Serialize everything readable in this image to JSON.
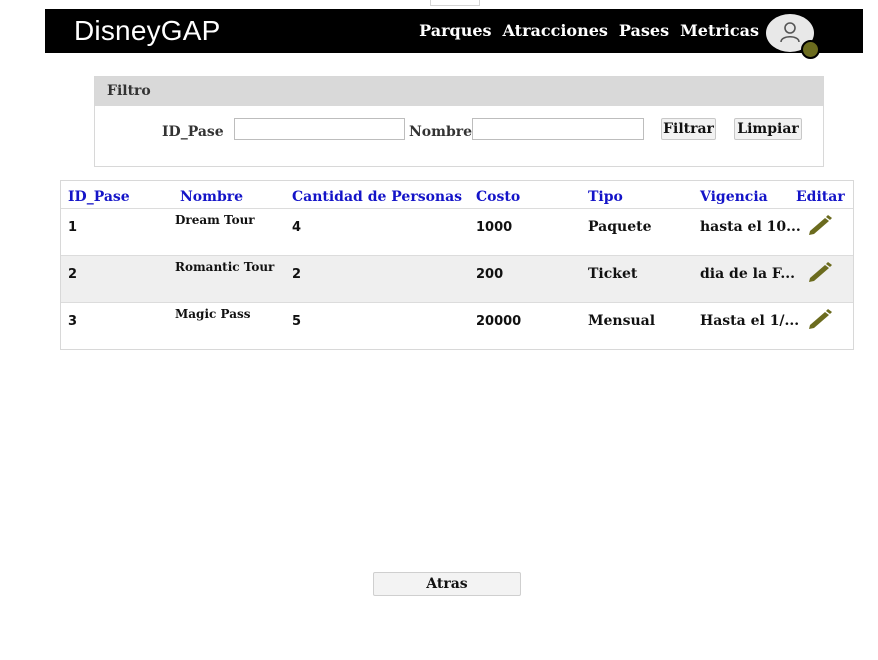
{
  "app": {
    "brand": "DisneyGAP"
  },
  "nav": {
    "items": [
      "Parques",
      "Atracciones",
      "Pases",
      "Metricas"
    ]
  },
  "filter": {
    "title": "Filtro",
    "id_label": "ID_Pase",
    "id_value": "",
    "name_label": "Nombre",
    "name_value": "",
    "filter_button": "Filtrar",
    "clear_button": "Limpiar"
  },
  "table": {
    "headers": [
      "ID_Pase",
      "Nombre",
      "Cantidad de Personas",
      "Costo",
      "Tipo",
      "Vigencia",
      "Editar"
    ],
    "rows": [
      {
        "id": "1",
        "name": "Dream Tour",
        "people": "4",
        "cost": "1000",
        "type": "Paquete",
        "validity": "hasta el 10..."
      },
      {
        "id": "2",
        "name": "Romantic Tour",
        "people": "2",
        "cost": "200",
        "type": "Ticket",
        "validity": "dia de la F..."
      },
      {
        "id": "3",
        "name": "Magic Pass",
        "people": "5",
        "cost": "20000",
        "type": "Mensual",
        "validity": "Hasta el 1/..."
      }
    ]
  },
  "footer": {
    "back_button": "Atras"
  },
  "colors": {
    "header_link": "#1414c8",
    "accent_olive": "#6b6b1e",
    "navbar": "#000000"
  }
}
